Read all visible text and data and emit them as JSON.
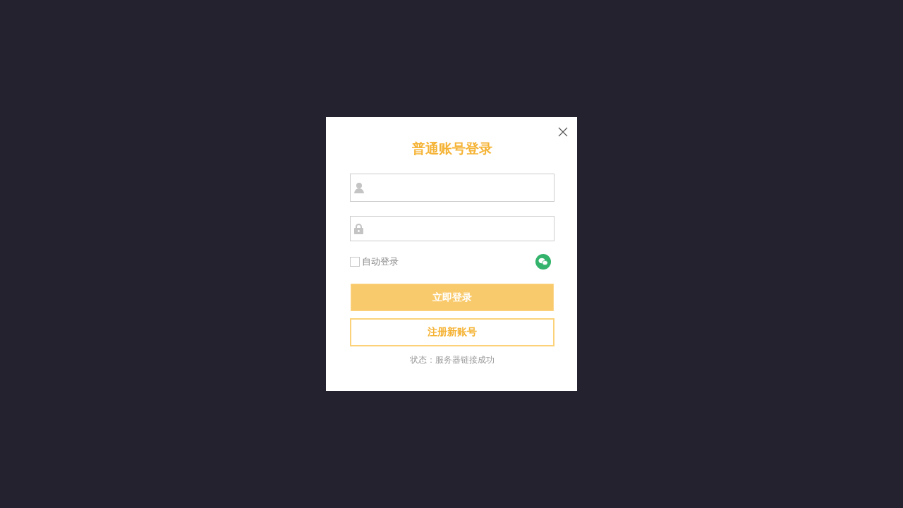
{
  "dialog": {
    "title": "普通账号登录",
    "fields": [
      {
        "kind": "user"
      },
      {
        "kind": "password"
      }
    ],
    "auto_login": {
      "label": "自动登录",
      "checked": false
    },
    "buttons": [
      {
        "kind": "primary",
        "label": "立即登录"
      },
      {
        "kind": "secondary",
        "label": "注册新账号"
      }
    ],
    "status": "状态：服务器链接成功"
  }
}
